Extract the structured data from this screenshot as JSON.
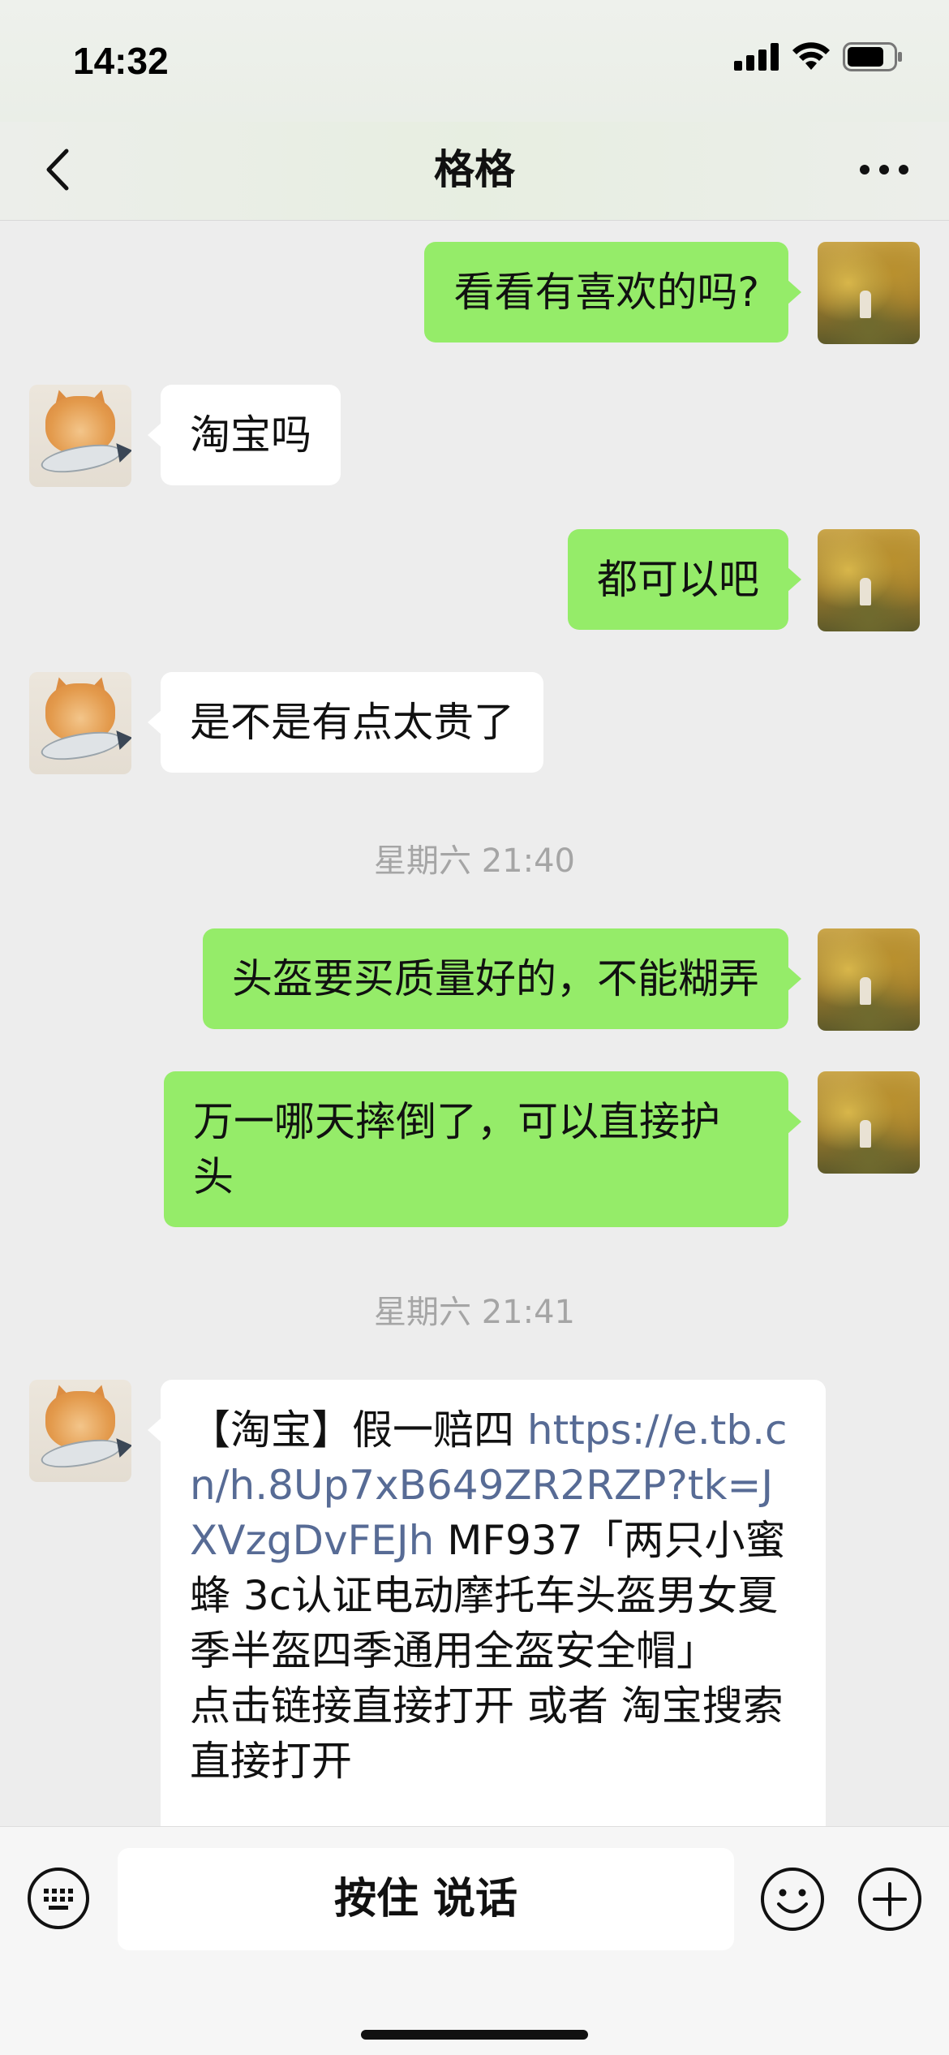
{
  "status_bar": {
    "time": "14:32"
  },
  "nav": {
    "title": "格格"
  },
  "messages": [
    {
      "side": "right",
      "text": "看看有喜欢的吗?"
    },
    {
      "side": "left",
      "text": "淘宝吗"
    },
    {
      "side": "right",
      "text": "都可以吧"
    },
    {
      "side": "left",
      "text": "是不是有点太贵了"
    },
    {
      "timestamp": "星期六 21:40"
    },
    {
      "side": "right",
      "text": "头盔要买质量好的，不能糊弄"
    },
    {
      "side": "right",
      "text": "万一哪天摔倒了，可以直接护头"
    },
    {
      "timestamp": "星期六 21:41"
    },
    {
      "side": "left",
      "prefix": "【淘宝】假一赔四 ",
      "link": "https://e.tb.cn/h.8Up7xB649ZR2RZP?tk=JXVzgDvFEJh",
      "suffix": " MF937「两只小蜜蜂 3c认证电动摩托车头盔男女夏季半盔四季通用全盔安全帽」",
      "suffix2": "点击链接直接打开 或者 淘宝搜索直接打开"
    }
  ],
  "input_bar": {
    "hold_to_talk": "按住 说话"
  },
  "colors": {
    "sent_bubble": "#95ec69",
    "received_bubble": "#ffffff",
    "link": "#576b95",
    "background": "#ededed"
  },
  "icons": [
    "back-icon",
    "more-icon",
    "keyboard-icon",
    "emoji-icon",
    "plus-icon",
    "signal-icon",
    "wifi-icon",
    "battery-icon"
  ]
}
